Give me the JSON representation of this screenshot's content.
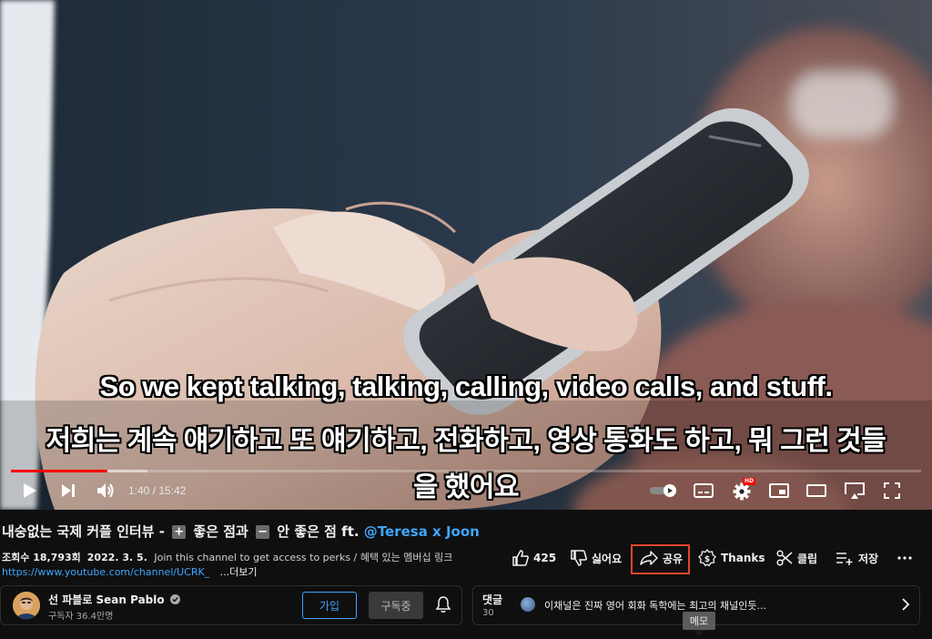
{
  "player": {
    "subtitles": [
      "So we kept talking, talking, calling, video calls, and stuff.",
      "저희는 계속 얘기하고 또 얘기하고, 전화하고, 영상 통화도 하고, 뭐 그런 것들",
      "을 했어요"
    ],
    "time_display": "1:40 / 15:42",
    "progress_fraction": 0.106,
    "settings_badge": "HD",
    "colors": {
      "progress": "#ff0000",
      "accent_link": "#3ea6ff"
    }
  },
  "video": {
    "title_part1": "내숭없는 국제 커플 인터뷰 -",
    "plus_symbol": "+",
    "title_part2": "좋은 점과",
    "minus_symbol": "−",
    "title_part3": "안 좋은 점 ft.",
    "title_mention": "@Teresa x Joon",
    "views": "조회수 18,793회",
    "date": "2022. 3. 5.",
    "description": "Join this channel to get access to perks / 혜택 있는 멤버십 링크",
    "link": "https://www.youtube.com/channel/UCRK_",
    "more": "...더보기"
  },
  "actions": {
    "like_count": "425",
    "dislike_label": "싫어요",
    "share_label": "공유",
    "thanks_label": "Thanks",
    "clip_label": "클립",
    "save_label": "저장",
    "more_icon": "more-horizontal-icon"
  },
  "channel": {
    "name": "선 파블로 Sean Pablo",
    "subscribers": "구독자 36.4만명",
    "join_label": "가입",
    "subscribed_label": "구독중"
  },
  "comments": {
    "label": "댓글",
    "count": "30",
    "preview": "이채널은 진짜 영어 회화 독학에는 최고의 채널인듯..."
  },
  "tooltip": {
    "text": "메모"
  }
}
